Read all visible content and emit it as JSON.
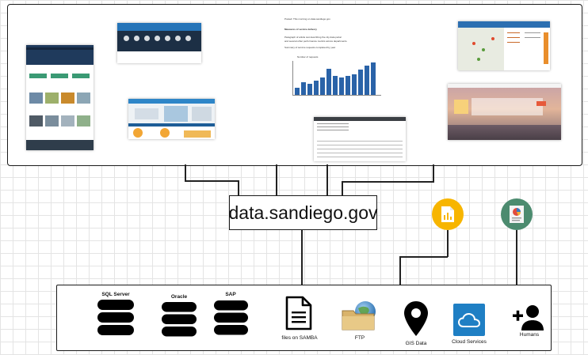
{
  "center": {
    "label": "data.sandiego.gov"
  },
  "sources": {
    "sql_server": "SQL Server",
    "oracle": "Oracle",
    "sap": "SAP",
    "samba": "files on SAMBA",
    "ftp": "FTP",
    "gis": "GIS Data",
    "cloud": "Cloud Services",
    "humans": "Humans"
  },
  "icons": {
    "sheets": "google-sheets-icon",
    "report": "report-document-icon"
  },
  "screenshots": [
    "portal-homepage-screenshot",
    "performance-dashboard-screenshot",
    "map-dashboard-screenshot",
    "blog-post-chart-screenshot",
    "data-table-screenshot",
    "map-app-screenshot",
    "city-landing-page-screenshot"
  ],
  "colors": {
    "sheets_bg": "#f7b500",
    "report_bg": "#4c8b6f",
    "cloud_bg": "#1f7fc4"
  }
}
